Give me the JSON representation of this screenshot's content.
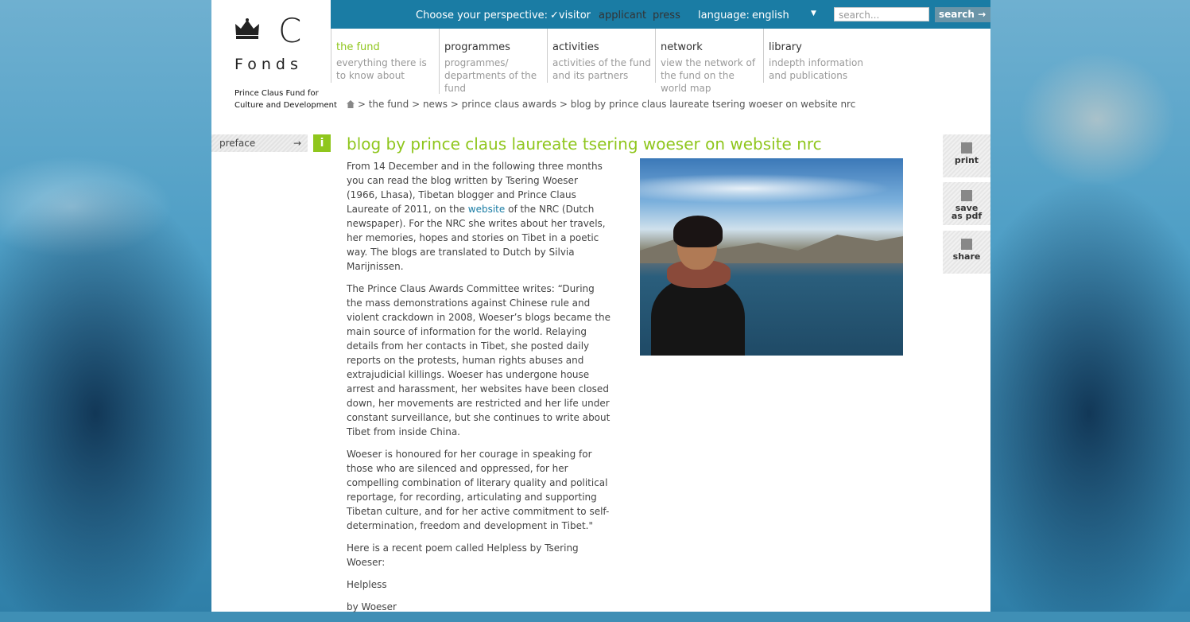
{
  "logo": {
    "letter": "C",
    "wordmark": "Fonds",
    "subtitle_line1": "Prince Claus Fund for",
    "subtitle_line2": "Culture and Development"
  },
  "topbar": {
    "perspective_label": "Choose your perspective:",
    "perspectives": [
      "visitor",
      "applicant",
      "press"
    ],
    "selected_perspective": "visitor",
    "language_label": "language:",
    "language_value": "english",
    "search_placeholder": "search...",
    "search_button": "search"
  },
  "nav": [
    {
      "title": "the fund",
      "desc": "everything there is to know about"
    },
    {
      "title": "programmes",
      "desc": "programmes/ departments of the fund"
    },
    {
      "title": "activities",
      "desc": "activities of the fund and its partners"
    },
    {
      "title": "network",
      "desc": "view the network of the fund on the world map"
    },
    {
      "title": "library",
      "desc": "indepth information and publications"
    }
  ],
  "breadcrumb": "> the fund > news > prince claus awards > blog by prince claus laureate tsering woeser on website nrc",
  "sidebar": {
    "preface": "preface",
    "info": "i"
  },
  "article": {
    "title": "blog by prince claus laureate tsering woeser on website nrc",
    "p1_before": "From 14 December and in the following three months you can read the blog written by Tsering Woeser (1966, Lhasa), Tibetan blogger and Prince Claus Laureate of 2011, on the ",
    "p1_link": "website",
    "p1_after": " of the NRC (Dutch newspaper). For the NRC she writes about her travels, her memories, hopes and stories on Tibet in a poetic way. The blogs are translated to Dutch by Silvia Marijnissen.",
    "p2": "The Prince Claus Awards Committee writes: “During the mass demonstrations against Chinese rule and violent crackdown in 2008, Woeser’s blogs became the main source of information for the world. Relaying details from her contacts in Tibet, she posted daily reports on the protests, human rights abuses and extrajudicial killings. Woeser has undergone house arrest and harassment, her websites have been closed down, her movements are restricted and her life under constant surveillance, but she continues to write about Tibet from inside China.",
    "p3": "Woeser is honoured for her courage in speaking for those who are silenced and oppressed, for her compelling combination of literary quality and political reportage, for recording, articulating and supporting Tibetan culture, and for her active commitment to self-determination, freedom and development in Tibet.\"",
    "p4": "Here is a recent poem called Helpless by Tsering Woeser:",
    "p5": "Helpless",
    "p6": "by Woeser"
  },
  "tools": {
    "print": "print",
    "pdf_line1": "save",
    "pdf_line2": "as pdf",
    "share": "share"
  },
  "colors": {
    "accent_green": "#8fc61d",
    "topbar_blue": "#1a7ca4"
  }
}
